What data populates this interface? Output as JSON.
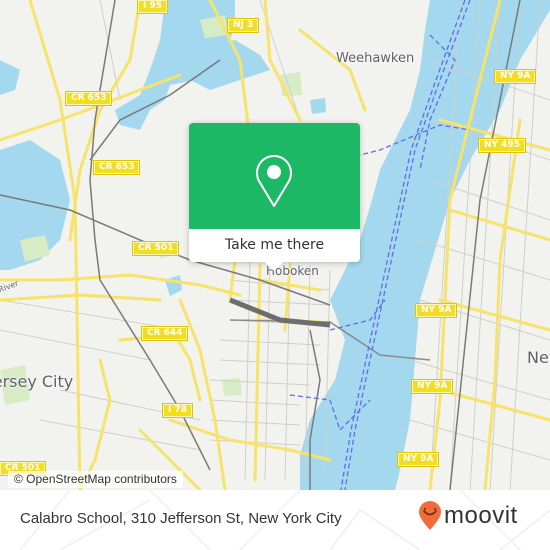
{
  "map": {
    "colors": {
      "land": "#f2f2ee",
      "water": "#a3d8ee",
      "park": "#d7ebc4",
      "major_road": "#f7e36a",
      "minor_road": "#c9c9c4",
      "rail": "#7a7a7a",
      "ferry": "#5b6ef0",
      "shield": "#f2dd20"
    },
    "road_labels": [
      {
        "id": "i95",
        "text": "I 95"
      },
      {
        "id": "nj3",
        "text": "NJ 3"
      },
      {
        "id": "cr653-a",
        "text": "CR 653"
      },
      {
        "id": "cr653-b",
        "text": "CR 653"
      },
      {
        "id": "cr501-a",
        "text": "CR 501"
      },
      {
        "id": "cr644",
        "text": "CR 644"
      },
      {
        "id": "i78",
        "text": "I 78"
      },
      {
        "id": "cr501-b",
        "text": "CR 501"
      },
      {
        "id": "ny9a-a",
        "text": "NY 9A"
      },
      {
        "id": "ny495",
        "text": "NY 495"
      },
      {
        "id": "ny9a-b",
        "text": "NY 9A"
      },
      {
        "id": "ny9a-c",
        "text": "NY 9A"
      },
      {
        "id": "ny9a-d",
        "text": "NY 9A"
      }
    ],
    "place_labels": {
      "weehawken": "Weehawken",
      "hoboken": "Hoboken",
      "jersey_city": "Jersey City",
      "new_york": "New",
      "river": "River"
    },
    "attribution": "© OpenStreetMap contributors"
  },
  "popup": {
    "icon": "map-pin-icon",
    "cta_label": "Take me there",
    "color": "#1db866"
  },
  "footer": {
    "address": "Calabro School, 310 Jefferson St, New York City",
    "brand": "moovit",
    "brand_icon": "moovit-pin-smile-icon",
    "brand_color": "#f26b3a"
  }
}
